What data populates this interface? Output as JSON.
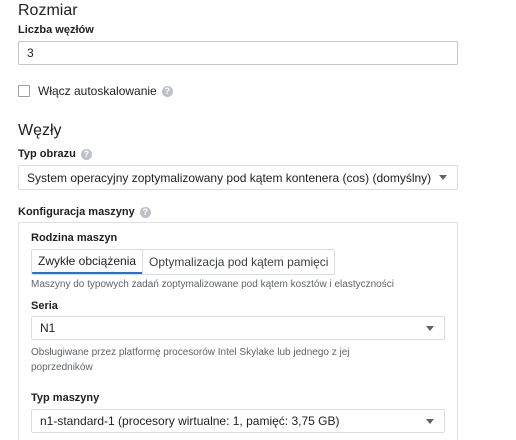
{
  "size_section": {
    "title": "Rozmiar",
    "node_count_label": "Liczba węzłów",
    "node_count_value": "3",
    "autoscale_label": "Włącz autoskalowanie"
  },
  "nodes_section": {
    "title": "Węzły",
    "image_type_label": "Typ obrazu",
    "image_type_value": "System operacyjny zoptymalizowany pod kątem kontenera (cos) (domyślny)",
    "machine_config_label": "Konfiguracja maszyny"
  },
  "machine_config": {
    "family_label": "Rodzina maszyn",
    "family_tabs": [
      {
        "label": "Zwykłe obciążenia",
        "active": true
      },
      {
        "label": "Optymalizacja pod kątem pamięci",
        "active": false
      }
    ],
    "family_hint": "Maszyny do typowych zadań zoptymalizowane pod kątem kosztów i elastyczności",
    "series_label": "Seria",
    "series_value": "N1",
    "series_hint_line1": "Obsługiwane przez platformę procesorów Intel Skylake lub jednego z jej",
    "series_hint_line2": "poprzedników",
    "machine_type_label": "Typ maszyny",
    "machine_type_value": "n1-standard-1 (procesory wirtualne: 1, pamięć: 3,75 GB)"
  },
  "icons": {
    "help": "?",
    "help_icon_name": "help-circle-icon",
    "caret_icon_name": "chevron-down-icon"
  },
  "colors": {
    "accent": "#1a73e8",
    "text": "#202124",
    "hint": "#5f6368",
    "border": "#dadce0"
  }
}
